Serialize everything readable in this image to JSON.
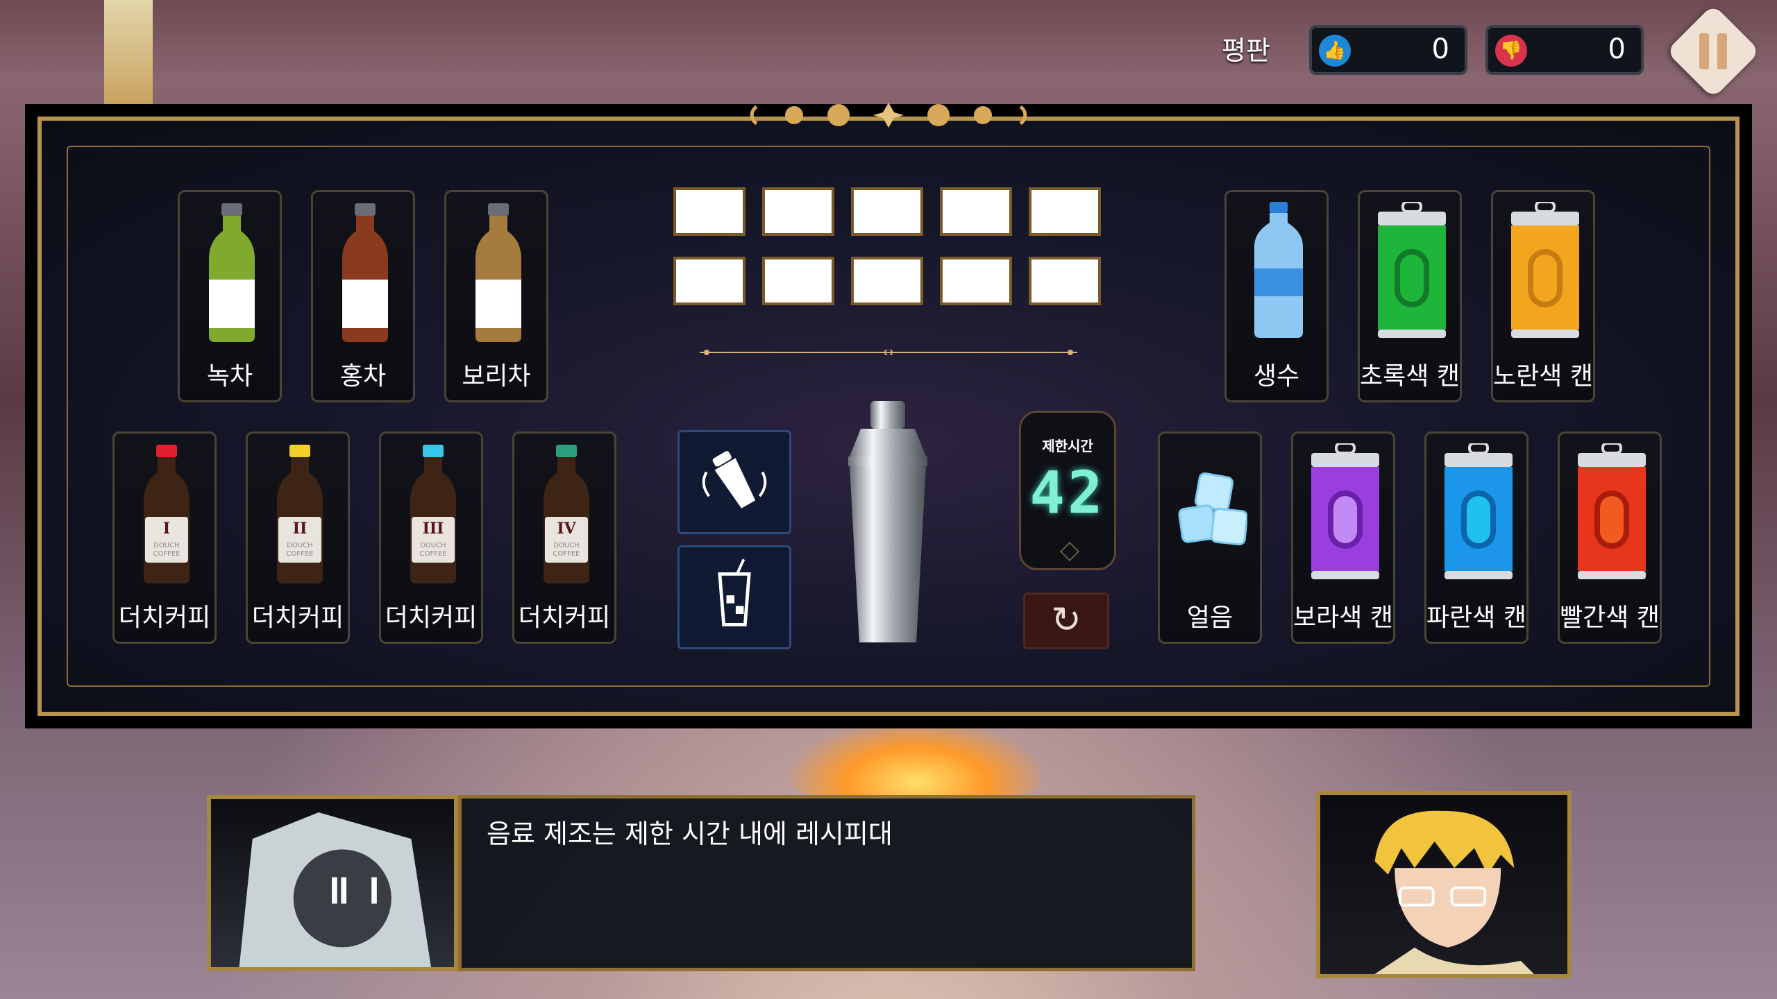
{
  "reputation": {
    "label": "평판",
    "likes": "0",
    "dislikes": "0"
  },
  "top_row_left": [
    {
      "label": "녹차",
      "top_color": "#7faa2e",
      "bottom_color": "#ffffff",
      "cap": "#6a6d75"
    },
    {
      "label": "홍차",
      "top_color": "#8a3a1e",
      "bottom_color": "#ffffff",
      "cap": "#6a6d75"
    },
    {
      "label": "보리차",
      "top_color": "#a67c3e",
      "bottom_color": "#ffffff",
      "cap": "#6a6d75"
    }
  ],
  "bottom_row_left": [
    {
      "label": "더치커피",
      "cap": "#e0202c",
      "numeral": "I"
    },
    {
      "label": "더치커피",
      "cap": "#f3cf2a",
      "numeral": "II"
    },
    {
      "label": "더치커피",
      "cap": "#38c7ea",
      "numeral": "III"
    },
    {
      "label": "더치커피",
      "cap": "#2ba07c",
      "numeral": "IV"
    }
  ],
  "top_row_right": [
    {
      "label": "생수",
      "kind": "water"
    },
    {
      "label": "초록색 캔",
      "kind": "can",
      "color": "#1db53a"
    },
    {
      "label": "노란색 캔",
      "kind": "can",
      "color": "#f3a51e"
    }
  ],
  "bottom_row_right": [
    {
      "label": "얼음",
      "kind": "ice"
    },
    {
      "label": "보라색 캔",
      "kind": "can",
      "color": "#9a3ee0"
    },
    {
      "label": "파란색 캔",
      "kind": "can",
      "color": "#1c96ea"
    },
    {
      "label": "빨간색 캔",
      "kind": "can",
      "color": "#e8361c"
    }
  ],
  "coffee_brand": "DOUCH COFFEE",
  "recipe_slots": 10,
  "actions": {
    "shake": "shake-icon",
    "pour": "cup-icon"
  },
  "timer": {
    "label": "제한시간",
    "value": "42"
  },
  "dialog": {
    "text": "음료 제조는 제한 시간 내에 레시피대"
  }
}
